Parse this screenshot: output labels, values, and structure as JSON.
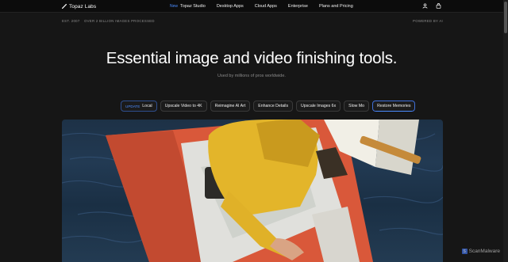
{
  "brand": {
    "name": "Topaz Labs"
  },
  "nav": {
    "items": [
      {
        "tag": "New",
        "label": "Topaz Studio"
      },
      {
        "tag": "",
        "label": "Desktop Apps"
      },
      {
        "tag": "",
        "label": "Cloud Apps"
      },
      {
        "tag": "",
        "label": "Enterprise"
      },
      {
        "tag": "",
        "label": "Plans and Pricing"
      }
    ],
    "icons": [
      "user-icon",
      "shopping-bag-icon"
    ]
  },
  "info": {
    "est": "EST. 2007",
    "count": "OVER 2 BILLION IMAGES PROCESSED",
    "powered": "POWERED BY AI"
  },
  "hero": {
    "headline": "Essential image and video finishing tools.",
    "subline": "Used by millions of pros worldwide."
  },
  "tabs": [
    {
      "tag": "UPDATE",
      "label": "Local",
      "active": false
    },
    {
      "tag": "",
      "label": "Upscale Video to 4K",
      "active": false
    },
    {
      "tag": "",
      "label": "Reimagine AI Art",
      "active": false
    },
    {
      "tag": "",
      "label": "Enhance Details",
      "active": false
    },
    {
      "tag": "",
      "label": "Upscale Images 6x",
      "active": false
    },
    {
      "tag": "",
      "label": "Slow Mo",
      "active": false
    },
    {
      "tag": "",
      "label": "Restore Memories",
      "active": true
    }
  ],
  "watermark": {
    "text": "ScanMalware"
  },
  "colors": {
    "accent": "#4b8cff",
    "background": "#161616",
    "boat_hull": "#d9583a",
    "jacket": "#e3b52a"
  }
}
